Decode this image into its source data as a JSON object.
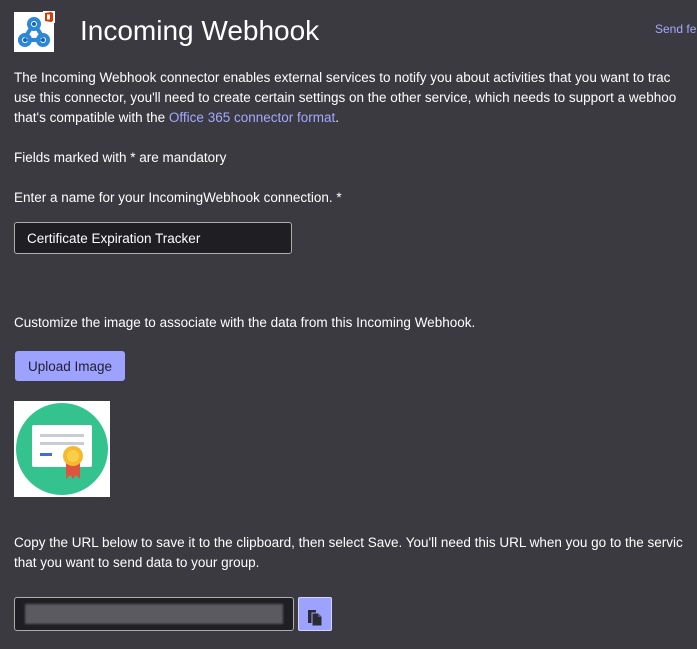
{
  "header": {
    "title": "Incoming Webhook",
    "send_feedback": "Send fe",
    "logo_icon": "webhook-logo-icon",
    "badge_icon": "office-badge-icon"
  },
  "description": {
    "line1": "The Incoming Webhook connector enables external services to notify you about activities that you want to trac",
    "line2": "use this connector, you'll need to create certain settings on the other service, which needs to support a webhoo",
    "line3_prefix": "that's compatible with the ",
    "line3_link": "Office 365 connector format",
    "line3_suffix": "."
  },
  "mandatory_note": "Fields marked with * are mandatory",
  "name_section": {
    "label": "Enter a name for your IncomingWebhook connection. *",
    "value": "Certificate Expiration Tracker"
  },
  "image_section": {
    "label": "Customize the image to associate with the data from this Incoming Webhook.",
    "upload_label": "Upload Image",
    "image_icon": "certificate-icon"
  },
  "url_section": {
    "line1": "Copy the URL below to save it to the clipboard, then select Save. You'll need this URL when you go to the servic",
    "line2": "that you want to send data to your group.",
    "copy_icon": "copy-icon"
  },
  "colors": {
    "background": "#3b3a40",
    "accent": "#9ea2ff",
    "link": "#a4a9ff",
    "input_bg": "#1f1e22"
  }
}
